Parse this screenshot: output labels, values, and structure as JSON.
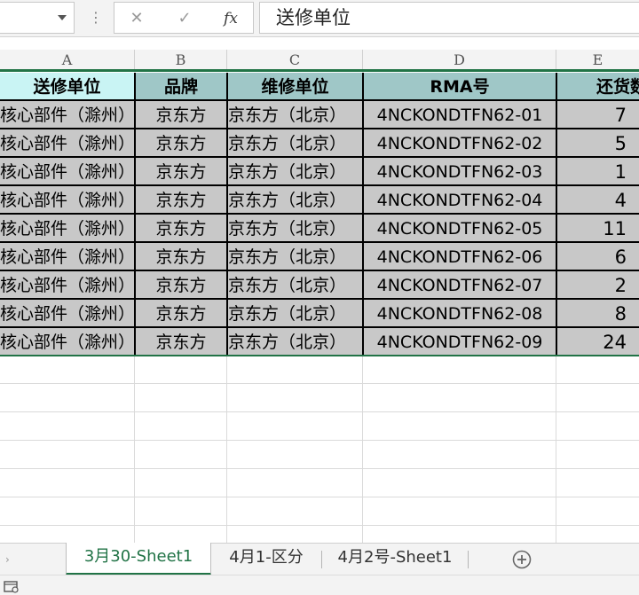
{
  "formula_bar": {
    "cancel_glyph": "✕",
    "enter_glyph": "✓",
    "fx_label": "fx",
    "value": "送修单位"
  },
  "columns": [
    "A",
    "B",
    "C",
    "D",
    "E"
  ],
  "table": {
    "headers": [
      "送修单位",
      "品牌",
      "维修单位",
      "RMA号",
      "还货数"
    ],
    "rows": [
      [
        "核心部件（滁州）",
        "京东方",
        "京东方（北京）",
        "4NCKONDTFN62-01",
        "7"
      ],
      [
        "核心部件（滁州）",
        "京东方",
        "京东方（北京）",
        "4NCKONDTFN62-02",
        "5"
      ],
      [
        "核心部件（滁州）",
        "京东方",
        "京东方（北京）",
        "4NCKONDTFN62-03",
        "1"
      ],
      [
        "核心部件（滁州）",
        "京东方",
        "京东方（北京）",
        "4NCKONDTFN62-04",
        "4"
      ],
      [
        "核心部件（滁州）",
        "京东方",
        "京东方（北京）",
        "4NCKONDTFN62-05",
        "11"
      ],
      [
        "核心部件（滁州）",
        "京东方",
        "京东方（北京）",
        "4NCKONDTFN62-06",
        "6"
      ],
      [
        "核心部件（滁州）",
        "京东方",
        "京东方（北京）",
        "4NCKONDTFN62-07",
        "2"
      ],
      [
        "核心部件（滁州）",
        "京东方",
        "京东方（北京）",
        "4NCKONDTFN62-08",
        "8"
      ],
      [
        "核心部件（滁州）",
        "京东方",
        "京东方（北京）",
        "4NCKONDTFN62-09",
        "24"
      ]
    ]
  },
  "sheet_tabs": [
    "3月30-Sheet1",
    "4月1-区分",
    "4月2号-Sheet1"
  ],
  "active_sheet": "3月30-Sheet1",
  "colors": {
    "accent": "#217346",
    "header_a_fill": "#c9f4f4",
    "header_fill": "#9fc7c7",
    "cell_fill": "#c8c8c8"
  },
  "icons": {
    "namebox_dropdown": "chevron-down-icon",
    "cancel": "close-icon",
    "enter": "check-icon",
    "function": "fx-icon",
    "add_sheet": "plus-circle-icon",
    "status": "macro-record-icon"
  }
}
